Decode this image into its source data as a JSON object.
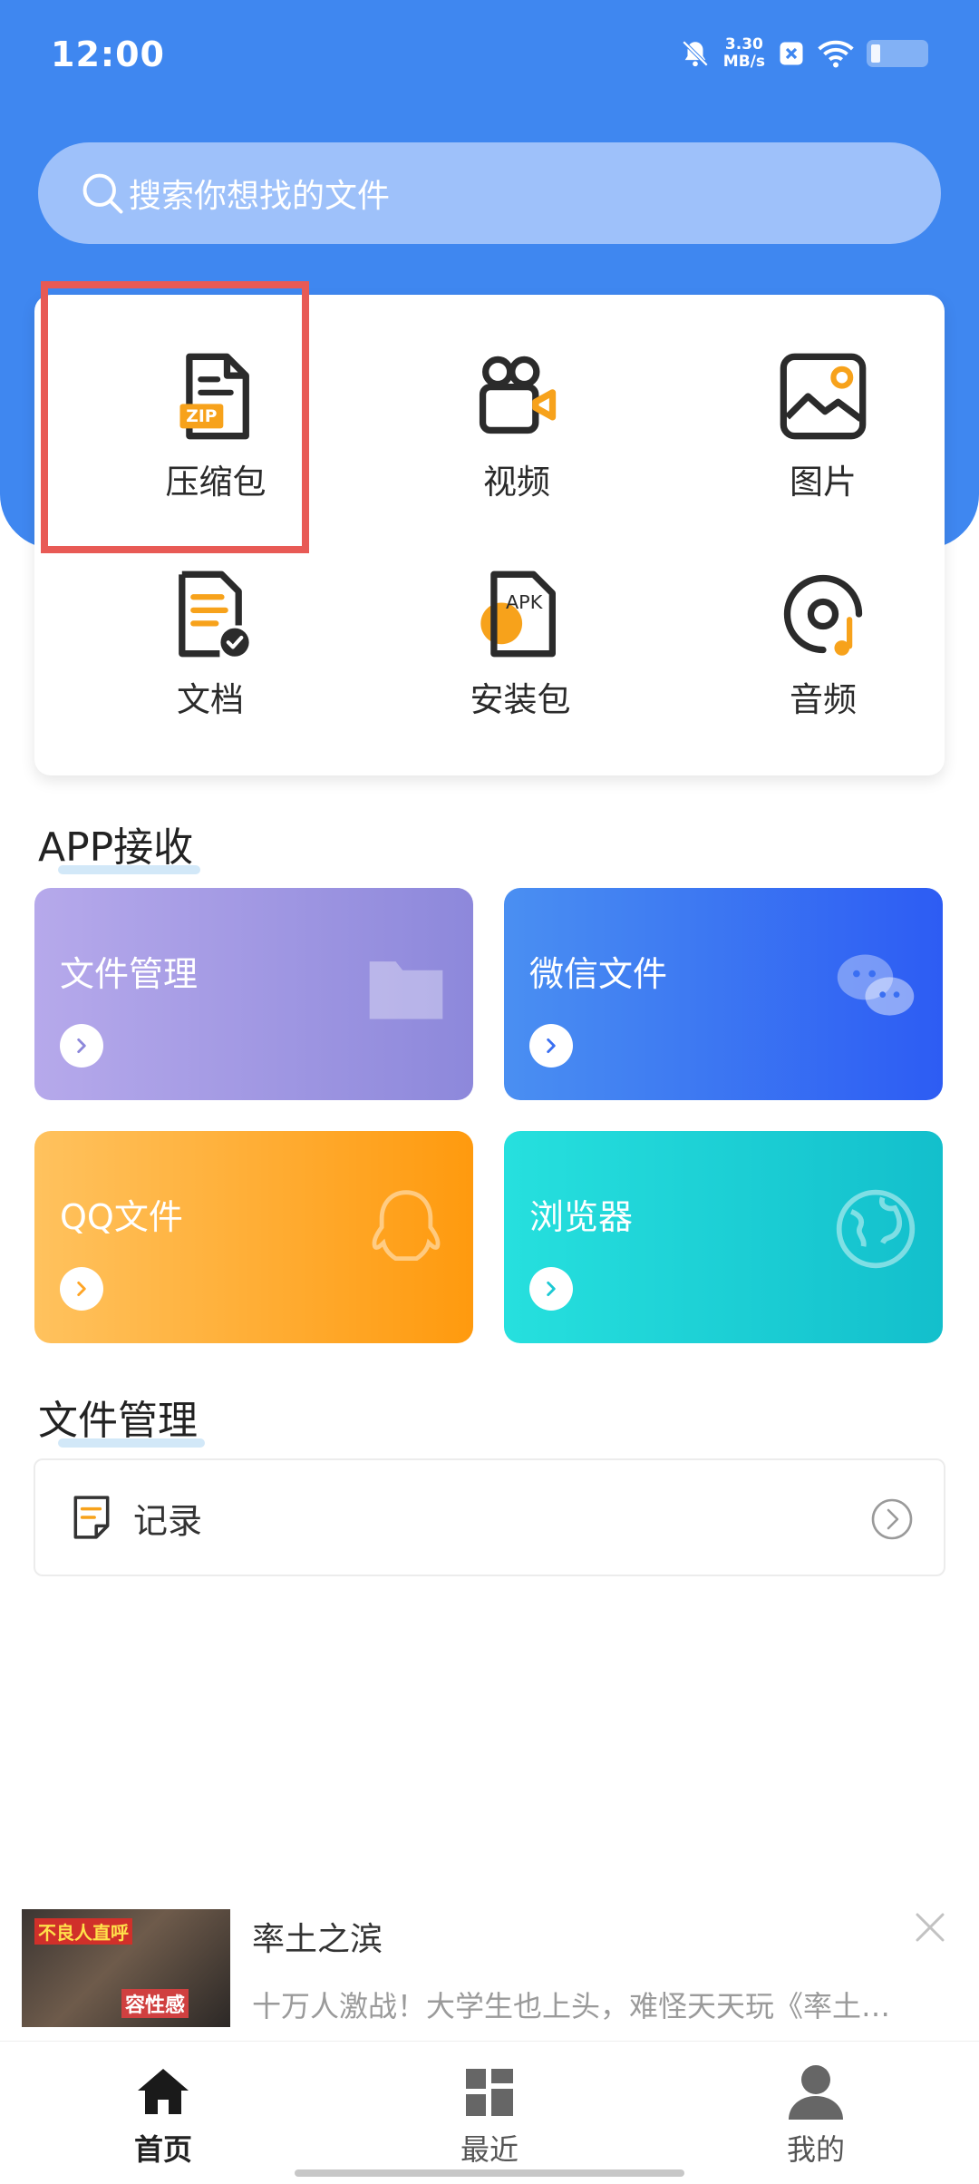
{
  "status_bar": {
    "time": "12:00",
    "net_speed_value": "3.30",
    "net_speed_unit": "MB/s",
    "icons": [
      "bell-off-icon",
      "app-notification-icon",
      "wifi-icon",
      "battery-icon"
    ]
  },
  "search": {
    "placeholder": "搜索你想找的文件",
    "icon": "search-icon"
  },
  "categories": [
    {
      "label": "压缩包",
      "icon": "zip-file-icon"
    },
    {
      "label": "视频",
      "icon": "video-camera-icon"
    },
    {
      "label": "图片",
      "icon": "image-icon"
    },
    {
      "label": "文档",
      "icon": "document-icon"
    },
    {
      "label": "安装包",
      "icon": "apk-icon"
    },
    {
      "label": "音频",
      "icon": "music-disc-icon"
    }
  ],
  "app_section": {
    "title": "APP接收",
    "cards": [
      {
        "label": "文件管理",
        "icon": "folder-icon",
        "color_start": "#b6a9eb",
        "color_end": "#8d88db"
      },
      {
        "label": "微信文件",
        "icon": "wechat-icon",
        "color_start": "#4a8ff2",
        "color_end": "#2d5cf3"
      },
      {
        "label": "QQ文件",
        "icon": "qq-icon",
        "color_start": "#ffc25e",
        "color_end": "#ff9a0e"
      },
      {
        "label": "浏览器",
        "icon": "globe-icon",
        "color_start": "#26e0de",
        "color_end": "#13bfcc"
      }
    ]
  },
  "file_section": {
    "title": "文件管理",
    "record_label": "记录"
  },
  "ad": {
    "title": "率土之滨",
    "description": "十万人激战！大学生也上头，难怪天天玩《率土…",
    "thumb_text_top": "不良人直呼",
    "thumb_text_bottom": "容性感"
  },
  "bottom_nav": {
    "items": [
      {
        "label": "首页",
        "icon": "home-icon",
        "active": true
      },
      {
        "label": "最近",
        "icon": "recent-grid-icon",
        "active": false
      },
      {
        "label": "我的",
        "icon": "user-icon",
        "active": false
      }
    ]
  },
  "colors": {
    "header_blue": "#3f87f0",
    "highlight_red": "#e85a55",
    "accent_orange": "#f7a21b"
  }
}
